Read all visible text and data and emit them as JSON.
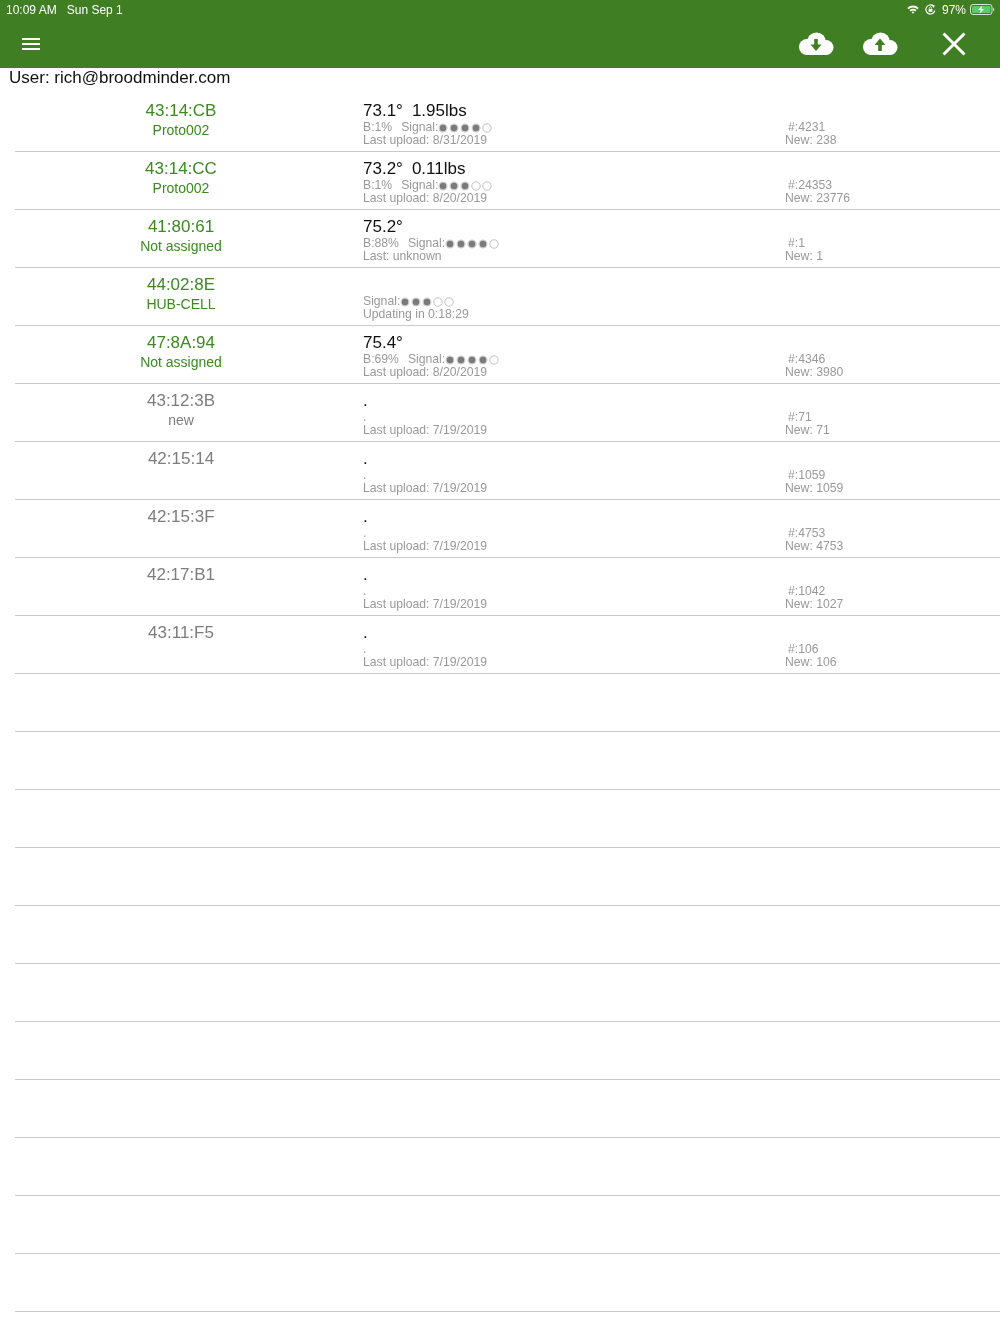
{
  "status_bar": {
    "time": "10:09 AM",
    "date": "Sun Sep 1",
    "battery_percent": "97%",
    "charging": true
  },
  "user": "User: rich@broodminder.com",
  "devices": [
    {
      "address": "43:14:CB",
      "name": "Proto002",
      "active": true,
      "readings": [
        "73.1°",
        "1.95lbs"
      ],
      "battery": "B:1%",
      "signal_label": "Signal:",
      "stars": 4,
      "last": "Last upload: 8/31/2019",
      "count": "#:4231",
      "new": "New: 238"
    },
    {
      "address": "43:14:CC",
      "name": "Proto002",
      "active": true,
      "readings": [
        "73.2°",
        "0.11lbs"
      ],
      "battery": "B:1%",
      "signal_label": "Signal:",
      "stars": 3,
      "last": "Last upload: 8/20/2019",
      "count": "#:24353",
      "new": "New: 23776"
    },
    {
      "address": "41:80:61",
      "name": "Not assigned",
      "active": true,
      "readings": [
        "75.2°"
      ],
      "battery": "B:88%",
      "signal_label": "Signal:",
      "stars": 4,
      "last": "Last: unknown",
      "count": "#:1",
      "new": "New: 1"
    },
    {
      "address": "44:02:8E",
      "name": "HUB-CELL",
      "active": true,
      "signal_label": "Signal:",
      "stars": 3,
      "last": "Updating in 0:18:29"
    },
    {
      "address": "47:8A:94",
      "name": "Not assigned",
      "active": true,
      "readings": [
        "75.4°"
      ],
      "battery": "B:69%",
      "signal_label": "Signal:",
      "stars": 4,
      "last": "Last upload: 8/20/2019",
      "count": "#:4346",
      "new": "New: 3980"
    },
    {
      "address": "43:12:3B",
      "name": "new",
      "active": false,
      "readings": [
        "."
      ],
      "detail": ".",
      "last": "Last upload: 7/19/2019",
      "count": "#:71",
      "new": "New: 71"
    },
    {
      "address": "42:15:14",
      "active": false,
      "readings": [
        "."
      ],
      "detail": ".",
      "last": "Last upload: 7/19/2019",
      "count": "#:1059",
      "new": "New: 1059"
    },
    {
      "address": "42:15:3F",
      "active": false,
      "readings": [
        "."
      ],
      "detail": ".",
      "last": "Last upload: 7/19/2019",
      "count": "#:4753",
      "new": "New: 4753"
    },
    {
      "address": "42:17:B1",
      "active": false,
      "readings": [
        "."
      ],
      "detail": ".",
      "last": "Last upload: 7/19/2019",
      "count": "#:1042",
      "new": "New: 1027"
    },
    {
      "address": "43:11:F5",
      "active": false,
      "readings": [
        "."
      ],
      "detail": ".",
      "last": "Last upload: 7/19/2019",
      "count": "#:106",
      "new": "New: 106"
    }
  ]
}
